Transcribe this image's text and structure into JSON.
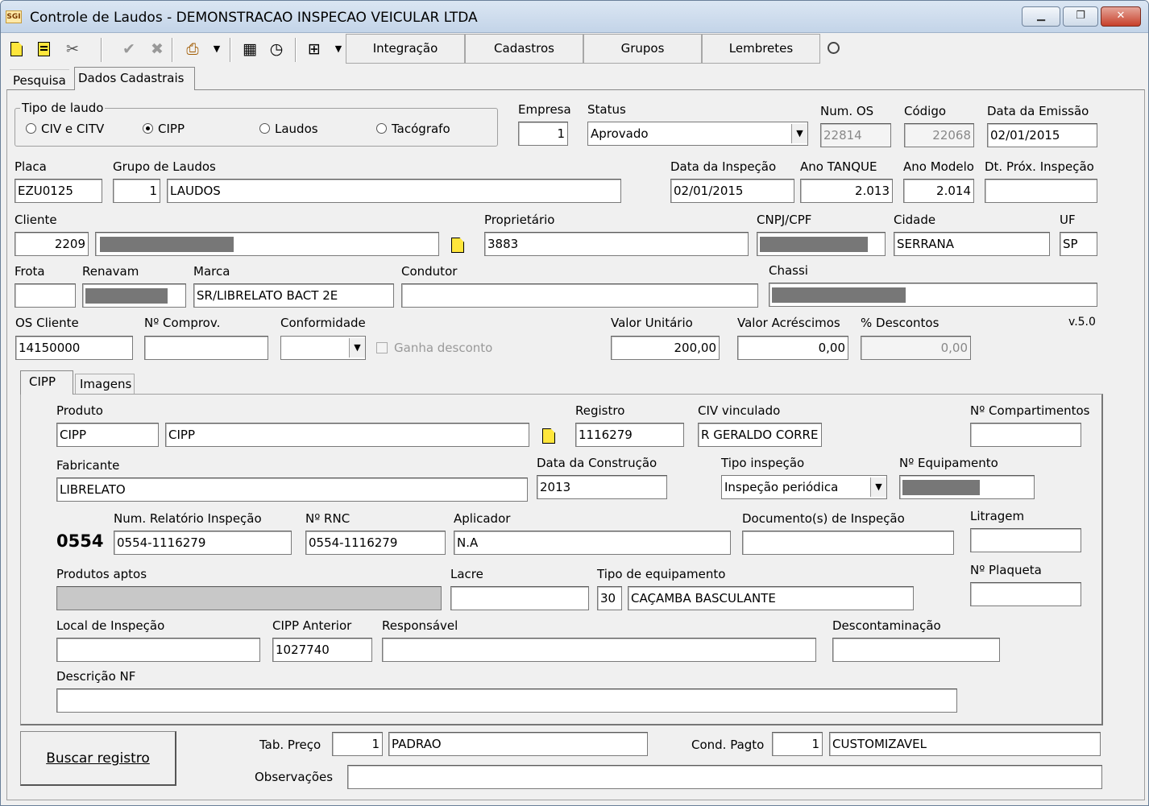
{
  "window": {
    "title": "Controle de Laudos - DEMONSTRACAO INSPECAO VEICULAR LTDA",
    "icon_text": "SGI",
    "minimize": "▁",
    "maximize": "❐",
    "close": "✕"
  },
  "toolbar": {
    "buttons": [
      "Integração",
      "Cadastros",
      "Grupos",
      "Lembretes"
    ]
  },
  "top_tabs": [
    "Pesquisa",
    "Dados Cadastrais"
  ],
  "tipo_laudo": {
    "label": "Tipo de laudo",
    "options": [
      "CIV e CITV",
      "CIPP",
      "Laudos",
      "Tacógrafo"
    ],
    "selected": "CIPP"
  },
  "empresa": {
    "label": "Empresa",
    "value": "1"
  },
  "status": {
    "label": "Status",
    "value": "Aprovado"
  },
  "num_os": {
    "label": "Num. OS",
    "value": "22814"
  },
  "codigo": {
    "label": "Código",
    "value": "22068"
  },
  "data_emissao": {
    "label": "Data da Emissão",
    "value": "02/01/2015"
  },
  "placa": {
    "label": "Placa",
    "value": "EZU0125"
  },
  "grupo_laudos": {
    "label": "Grupo de Laudos",
    "code": "1",
    "name": "LAUDOS"
  },
  "data_inspecao": {
    "label": "Data da Inspeção",
    "value": "02/01/2015"
  },
  "ano_tanque": {
    "label": "Ano TANQUE",
    "value": "2.013"
  },
  "ano_modelo": {
    "label": "Ano Modelo",
    "value": "2.014"
  },
  "dt_prox": {
    "label": "Dt. Próx. Inspeção",
    "value": ""
  },
  "cliente": {
    "label": "Cliente",
    "code": "2209"
  },
  "proprietario": {
    "label": "Proprietário",
    "value": "3883"
  },
  "cnpj": {
    "label": "CNPJ/CPF"
  },
  "cidade": {
    "label": "Cidade",
    "value": "SERRANA"
  },
  "uf": {
    "label": "UF",
    "value": "SP"
  },
  "frota": {
    "label": "Frota",
    "value": ""
  },
  "renavam": {
    "label": "Renavam"
  },
  "marca": {
    "label": "Marca",
    "value": "SR/LIBRELATO BACT 2E"
  },
  "condutor": {
    "label": "Condutor",
    "value": ""
  },
  "chassi": {
    "label": "Chassi"
  },
  "os_cliente": {
    "label": "OS Cliente",
    "value": "14150000"
  },
  "num_comprov": {
    "label": "Nº Comprov.",
    "value": ""
  },
  "conformidade": {
    "label": "Conformidade",
    "value": ""
  },
  "ganha_desconto": {
    "label": "Ganha desconto"
  },
  "valor_unitario": {
    "label": "Valor Unitário",
    "value": "200,00"
  },
  "valor_acrescimos": {
    "label": "Valor Acréscimos",
    "value": "0,00"
  },
  "descontos": {
    "label": "% Descontos",
    "value": "0,00"
  },
  "version": "v.5.0",
  "inner_tabs": [
    "CIPP",
    "Imagens"
  ],
  "produto": {
    "label": "Produto",
    "code": "CIPP",
    "name": "CIPP"
  },
  "registro": {
    "label": "Registro",
    "value": "1116279"
  },
  "civ_vinculado": {
    "label": "CIV vinculado",
    "value": "R GERALDO CORRE"
  },
  "n_compartimentos": {
    "label": "Nº Compartimentos",
    "value": ""
  },
  "fabricante": {
    "label": "Fabricante",
    "value": "LIBRELATO"
  },
  "data_construcao": {
    "label": "Data da Construção",
    "value": "2013"
  },
  "tipo_inspecao": {
    "label": "Tipo inspeção",
    "value": "Inspeção periódica"
  },
  "n_equipamento": {
    "label": "Nº Equipamento"
  },
  "prefix_code": "0554",
  "num_relatorio": {
    "label": "Num. Relatório Inspeção",
    "value": "0554-1116279"
  },
  "n_rnc": {
    "label": "Nº RNC",
    "value": "0554-1116279"
  },
  "aplicador": {
    "label": "Aplicador",
    "value": "N.A"
  },
  "documentos": {
    "label": "Documento(s) de Inspeção",
    "value": ""
  },
  "litragem": {
    "label": "Litragem",
    "value": ""
  },
  "produtos_aptos": {
    "label": "Produtos aptos",
    "value": ""
  },
  "lacre": {
    "label": "Lacre",
    "value": ""
  },
  "tipo_equipamento": {
    "label": "Tipo de equipamento",
    "code": "30",
    "name": "CAÇAMBA BASCULANTE"
  },
  "n_plaqueta": {
    "label": "Nº Plaqueta",
    "value": ""
  },
  "local_inspecao": {
    "label": "Local de Inspeção",
    "value": ""
  },
  "cipp_anterior": {
    "label": "CIPP Anterior",
    "value": "1027740"
  },
  "responsavel": {
    "label": "Responsável",
    "value": ""
  },
  "descontaminacao": {
    "label": "Descontaminação",
    "value": ""
  },
  "descricao_nf": {
    "label": "Descrição NF",
    "value": ""
  },
  "buscar": "Buscar registro",
  "tab_preco": {
    "label": "Tab. Preço",
    "code": "1",
    "name": "PADRAO"
  },
  "cond_pagto": {
    "label": "Cond. Pagto",
    "code": "1",
    "name": "CUSTOMIZAVEL"
  },
  "observacoes": {
    "label": "Observações",
    "value": ""
  }
}
